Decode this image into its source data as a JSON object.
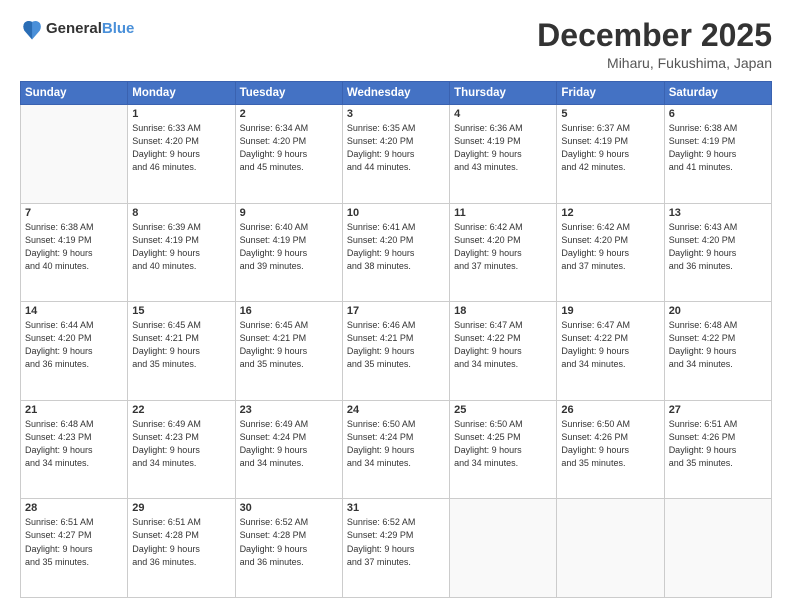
{
  "header": {
    "logo_general": "General",
    "logo_blue": "Blue",
    "month": "December 2025",
    "location": "Miharu, Fukushima, Japan"
  },
  "weekdays": [
    "Sunday",
    "Monday",
    "Tuesday",
    "Wednesday",
    "Thursday",
    "Friday",
    "Saturday"
  ],
  "weeks": [
    [
      {
        "day": "",
        "info": ""
      },
      {
        "day": "1",
        "info": "Sunrise: 6:33 AM\nSunset: 4:20 PM\nDaylight: 9 hours\nand 46 minutes."
      },
      {
        "day": "2",
        "info": "Sunrise: 6:34 AM\nSunset: 4:20 PM\nDaylight: 9 hours\nand 45 minutes."
      },
      {
        "day": "3",
        "info": "Sunrise: 6:35 AM\nSunset: 4:20 PM\nDaylight: 9 hours\nand 44 minutes."
      },
      {
        "day": "4",
        "info": "Sunrise: 6:36 AM\nSunset: 4:19 PM\nDaylight: 9 hours\nand 43 minutes."
      },
      {
        "day": "5",
        "info": "Sunrise: 6:37 AM\nSunset: 4:19 PM\nDaylight: 9 hours\nand 42 minutes."
      },
      {
        "day": "6",
        "info": "Sunrise: 6:38 AM\nSunset: 4:19 PM\nDaylight: 9 hours\nand 41 minutes."
      }
    ],
    [
      {
        "day": "7",
        "info": "Sunrise: 6:38 AM\nSunset: 4:19 PM\nDaylight: 9 hours\nand 40 minutes."
      },
      {
        "day": "8",
        "info": "Sunrise: 6:39 AM\nSunset: 4:19 PM\nDaylight: 9 hours\nand 40 minutes."
      },
      {
        "day": "9",
        "info": "Sunrise: 6:40 AM\nSunset: 4:19 PM\nDaylight: 9 hours\nand 39 minutes."
      },
      {
        "day": "10",
        "info": "Sunrise: 6:41 AM\nSunset: 4:20 PM\nDaylight: 9 hours\nand 38 minutes."
      },
      {
        "day": "11",
        "info": "Sunrise: 6:42 AM\nSunset: 4:20 PM\nDaylight: 9 hours\nand 37 minutes."
      },
      {
        "day": "12",
        "info": "Sunrise: 6:42 AM\nSunset: 4:20 PM\nDaylight: 9 hours\nand 37 minutes."
      },
      {
        "day": "13",
        "info": "Sunrise: 6:43 AM\nSunset: 4:20 PM\nDaylight: 9 hours\nand 36 minutes."
      }
    ],
    [
      {
        "day": "14",
        "info": "Sunrise: 6:44 AM\nSunset: 4:20 PM\nDaylight: 9 hours\nand 36 minutes."
      },
      {
        "day": "15",
        "info": "Sunrise: 6:45 AM\nSunset: 4:21 PM\nDaylight: 9 hours\nand 35 minutes."
      },
      {
        "day": "16",
        "info": "Sunrise: 6:45 AM\nSunset: 4:21 PM\nDaylight: 9 hours\nand 35 minutes."
      },
      {
        "day": "17",
        "info": "Sunrise: 6:46 AM\nSunset: 4:21 PM\nDaylight: 9 hours\nand 35 minutes."
      },
      {
        "day": "18",
        "info": "Sunrise: 6:47 AM\nSunset: 4:22 PM\nDaylight: 9 hours\nand 34 minutes."
      },
      {
        "day": "19",
        "info": "Sunrise: 6:47 AM\nSunset: 4:22 PM\nDaylight: 9 hours\nand 34 minutes."
      },
      {
        "day": "20",
        "info": "Sunrise: 6:48 AM\nSunset: 4:22 PM\nDaylight: 9 hours\nand 34 minutes."
      }
    ],
    [
      {
        "day": "21",
        "info": "Sunrise: 6:48 AM\nSunset: 4:23 PM\nDaylight: 9 hours\nand 34 minutes."
      },
      {
        "day": "22",
        "info": "Sunrise: 6:49 AM\nSunset: 4:23 PM\nDaylight: 9 hours\nand 34 minutes."
      },
      {
        "day": "23",
        "info": "Sunrise: 6:49 AM\nSunset: 4:24 PM\nDaylight: 9 hours\nand 34 minutes."
      },
      {
        "day": "24",
        "info": "Sunrise: 6:50 AM\nSunset: 4:24 PM\nDaylight: 9 hours\nand 34 minutes."
      },
      {
        "day": "25",
        "info": "Sunrise: 6:50 AM\nSunset: 4:25 PM\nDaylight: 9 hours\nand 34 minutes."
      },
      {
        "day": "26",
        "info": "Sunrise: 6:50 AM\nSunset: 4:26 PM\nDaylight: 9 hours\nand 35 minutes."
      },
      {
        "day": "27",
        "info": "Sunrise: 6:51 AM\nSunset: 4:26 PM\nDaylight: 9 hours\nand 35 minutes."
      }
    ],
    [
      {
        "day": "28",
        "info": "Sunrise: 6:51 AM\nSunset: 4:27 PM\nDaylight: 9 hours\nand 35 minutes."
      },
      {
        "day": "29",
        "info": "Sunrise: 6:51 AM\nSunset: 4:28 PM\nDaylight: 9 hours\nand 36 minutes."
      },
      {
        "day": "30",
        "info": "Sunrise: 6:52 AM\nSunset: 4:28 PM\nDaylight: 9 hours\nand 36 minutes."
      },
      {
        "day": "31",
        "info": "Sunrise: 6:52 AM\nSunset: 4:29 PM\nDaylight: 9 hours\nand 37 minutes."
      },
      {
        "day": "",
        "info": ""
      },
      {
        "day": "",
        "info": ""
      },
      {
        "day": "",
        "info": ""
      }
    ]
  ]
}
